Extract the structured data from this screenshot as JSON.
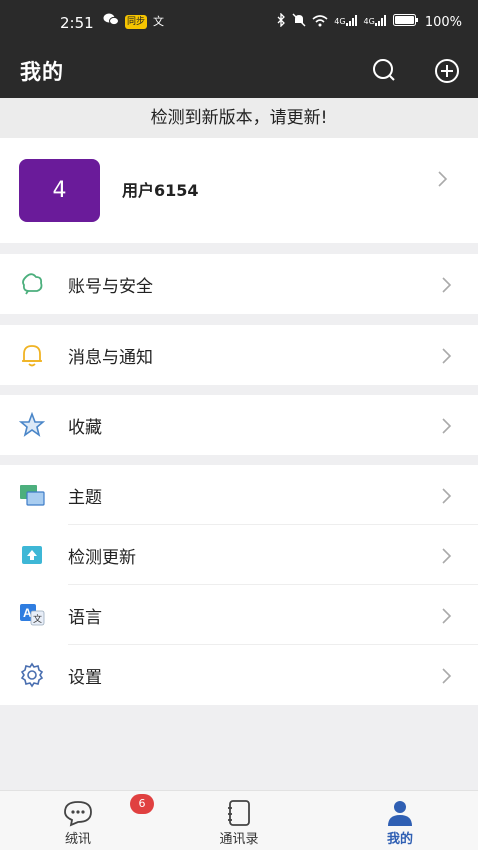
{
  "status_bar": {
    "time": "2:51",
    "left_icons": [
      "wechat-icon",
      "app-badge-icon",
      "translate-icon"
    ],
    "app_badge_text": "同步",
    "translate_char": "文",
    "right_icons": [
      "bluetooth-icon",
      "mute-icon",
      "wifi-icon",
      "signal-4g-icon",
      "signal-4g-icon",
      "battery-icon"
    ],
    "battery": "100%",
    "net1": "4G",
    "net2": "4G"
  },
  "app_bar": {
    "title": "我的",
    "actions": [
      "search-icon",
      "add-circle-icon"
    ]
  },
  "update_banner": "检测到新版本，请更新!",
  "profile": {
    "avatar_text": "4",
    "avatar_color": "#6a1b9a",
    "username": "用户6154"
  },
  "menu": {
    "account_security": "账号与安全",
    "messages_notifications": "消息与通知",
    "favorites": "收藏",
    "theme": "主题",
    "check_update": "检测更新",
    "language": "语言",
    "settings": "设置"
  },
  "tabs": [
    {
      "label": "绒讯",
      "icon": "chat-bubble-icon",
      "badge": "6",
      "active": false
    },
    {
      "label": "通讯录",
      "icon": "contacts-book-icon",
      "active": false
    },
    {
      "label": "我的",
      "icon": "person-icon",
      "active": true
    }
  ],
  "colors": {
    "accent": "#2f5fb3",
    "badge": "#e04040",
    "header": "#2a2a2a"
  }
}
